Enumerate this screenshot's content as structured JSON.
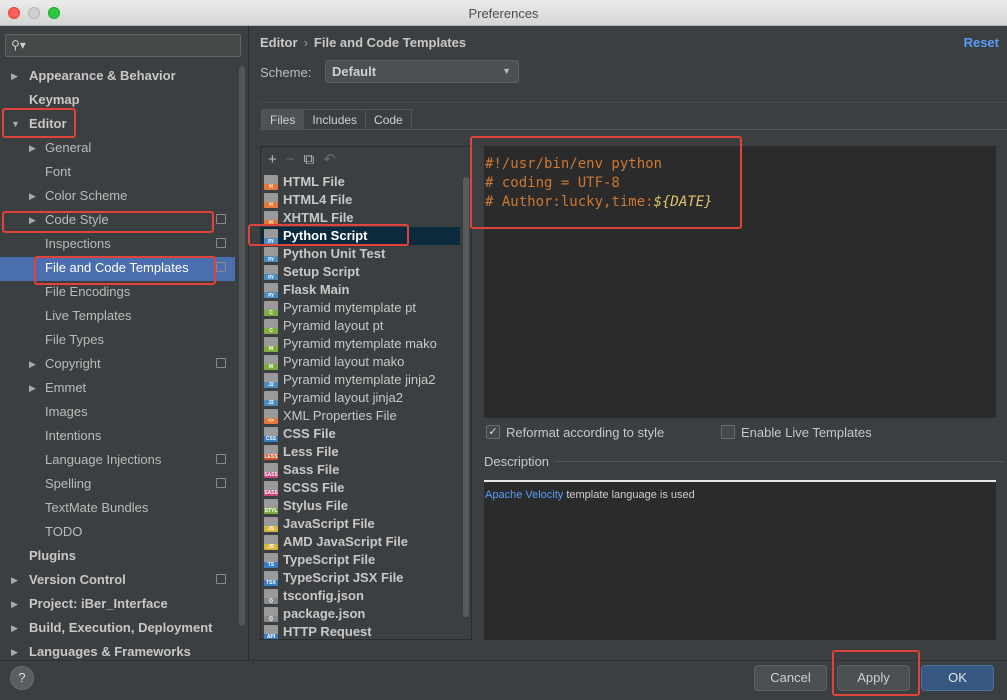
{
  "window": {
    "title": "Preferences"
  },
  "search": {
    "placeholder": "",
    "icon": "search-icon"
  },
  "sidebar": {
    "items": [
      {
        "label": "Appearance & Behavior",
        "bold": true,
        "arrow": "right"
      },
      {
        "label": "Keymap",
        "bold": true,
        "arrow": ""
      },
      {
        "label": "Editor",
        "bold": true,
        "arrow": "down"
      },
      {
        "label": "General",
        "bold": false,
        "arrow": "right"
      },
      {
        "label": "Font",
        "bold": false,
        "arrow": ""
      },
      {
        "label": "Color Scheme",
        "bold": false,
        "arrow": "right"
      },
      {
        "label": "Code Style",
        "bold": false,
        "arrow": "right"
      },
      {
        "label": "Inspections",
        "bold": false,
        "arrow": ""
      },
      {
        "label": "File and Code Templates",
        "bold": false,
        "arrow": ""
      },
      {
        "label": "File Encodings",
        "bold": false,
        "arrow": ""
      },
      {
        "label": "Live Templates",
        "bold": false,
        "arrow": ""
      },
      {
        "label": "File Types",
        "bold": false,
        "arrow": ""
      },
      {
        "label": "Copyright",
        "bold": false,
        "arrow": "right"
      },
      {
        "label": "Emmet",
        "bold": false,
        "arrow": "right"
      },
      {
        "label": "Images",
        "bold": false,
        "arrow": ""
      },
      {
        "label": "Intentions",
        "bold": false,
        "arrow": ""
      },
      {
        "label": "Language Injections",
        "bold": false,
        "arrow": ""
      },
      {
        "label": "Spelling",
        "bold": false,
        "arrow": ""
      },
      {
        "label": "TextMate Bundles",
        "bold": false,
        "arrow": ""
      },
      {
        "label": "TODO",
        "bold": false,
        "arrow": ""
      },
      {
        "label": "Plugins",
        "bold": true,
        "arrow": ""
      },
      {
        "label": "Version Control",
        "bold": true,
        "arrow": "right"
      },
      {
        "label": "Project: iBer_Interface",
        "bold": true,
        "arrow": "right"
      },
      {
        "label": "Build, Execution, Deployment",
        "bold": true,
        "arrow": "right"
      },
      {
        "label": "Languages & Frameworks",
        "bold": true,
        "arrow": "right"
      }
    ]
  },
  "header": {
    "breadcrumb_root": "Editor",
    "breadcrumb_sep": "›",
    "breadcrumb_page": "File and Code Templates",
    "reset_label": "Reset"
  },
  "scheme": {
    "label": "Scheme:",
    "value": "Default"
  },
  "tabs": [
    {
      "label": "Files",
      "active": true
    },
    {
      "label": "Includes",
      "active": false
    },
    {
      "label": "Code",
      "active": false
    }
  ],
  "toolbar": {
    "add": "+",
    "remove": "−"
  },
  "files": [
    {
      "name": "HTML File",
      "bold": true,
      "band": "H",
      "color": "#e2793a"
    },
    {
      "name": "HTML4 File",
      "bold": true,
      "band": "H",
      "color": "#e2793a"
    },
    {
      "name": "XHTML File",
      "bold": true,
      "band": "H",
      "color": "#e2793a"
    },
    {
      "name": "Python Script",
      "bold": true,
      "band": "py",
      "color": "#4b8bbe",
      "selected": true
    },
    {
      "name": "Python Unit Test",
      "bold": true,
      "band": "py",
      "color": "#4b8bbe"
    },
    {
      "name": "Setup Script",
      "bold": true,
      "band": "py",
      "color": "#4b8bbe"
    },
    {
      "name": "Flask Main",
      "bold": true,
      "band": "py",
      "color": "#4b8bbe"
    },
    {
      "name": "Pyramid mytemplate pt",
      "bold": false,
      "band": "C",
      "color": "#7fae3e"
    },
    {
      "name": "Pyramid layout pt",
      "bold": false,
      "band": "C",
      "color": "#7fae3e"
    },
    {
      "name": "Pyramid mytemplate mako",
      "bold": false,
      "band": "M",
      "color": "#7fae3e"
    },
    {
      "name": "Pyramid layout mako",
      "bold": false,
      "band": "M",
      "color": "#7fae3e"
    },
    {
      "name": "Pyramid mytemplate jinja2",
      "bold": false,
      "band": "J2",
      "color": "#4b8bbe"
    },
    {
      "name": "Pyramid layout jinja2",
      "bold": false,
      "band": "J2",
      "color": "#4b8bbe"
    },
    {
      "name": "XML Properties File",
      "bold": false,
      "band": "<>",
      "color": "#e2793a"
    },
    {
      "name": "CSS File",
      "bold": true,
      "band": "CSS",
      "color": "#3b7dc4"
    },
    {
      "name": "Less File",
      "bold": true,
      "band": "LESS",
      "color": "#d24f2a"
    },
    {
      "name": "Sass File",
      "bold": true,
      "band": "SASS",
      "color": "#c44680"
    },
    {
      "name": "SCSS File",
      "bold": true,
      "band": "SASS",
      "color": "#c44680"
    },
    {
      "name": "Stylus File",
      "bold": true,
      "band": "STYL",
      "color": "#7fae3e"
    },
    {
      "name": "JavaScript File",
      "bold": true,
      "band": "JS",
      "color": "#d9b63c"
    },
    {
      "name": "AMD JavaScript File",
      "bold": true,
      "band": "JS",
      "color": "#d9b63c"
    },
    {
      "name": "TypeScript File",
      "bold": true,
      "band": "TS",
      "color": "#3b7dc4"
    },
    {
      "name": "TypeScript JSX File",
      "bold": true,
      "band": "TSX",
      "color": "#3b7dc4"
    },
    {
      "name": "tsconfig.json",
      "bold": true,
      "band": "{}",
      "color": "#8a8a8a"
    },
    {
      "name": "package.json",
      "bold": true,
      "band": "{}",
      "color": "#8a8a8a"
    },
    {
      "name": "HTTP Request",
      "bold": true,
      "band": "API",
      "color": "#3b7dc4"
    }
  ],
  "editor": {
    "line1": "#!/usr/bin/env python",
    "line2": "# coding = UTF-8",
    "line3_prefix": "# Author:lucky,time:",
    "line3_var": "${DATE}"
  },
  "options": {
    "reformat_label": "Reformat according to style",
    "reformat_checked": true,
    "live_label": "Enable Live Templates",
    "live_checked": false
  },
  "description": {
    "label": "Description",
    "link_text": "Apache Velocity",
    "rest_text": " template language is used"
  },
  "buttons": {
    "help": "?",
    "cancel": "Cancel",
    "apply": "Apply",
    "ok": "OK"
  },
  "colors": {
    "accent": "#4b6eaf",
    "link": "#589df6",
    "keyword": "#cc7832",
    "annotation": "#e0433a"
  }
}
